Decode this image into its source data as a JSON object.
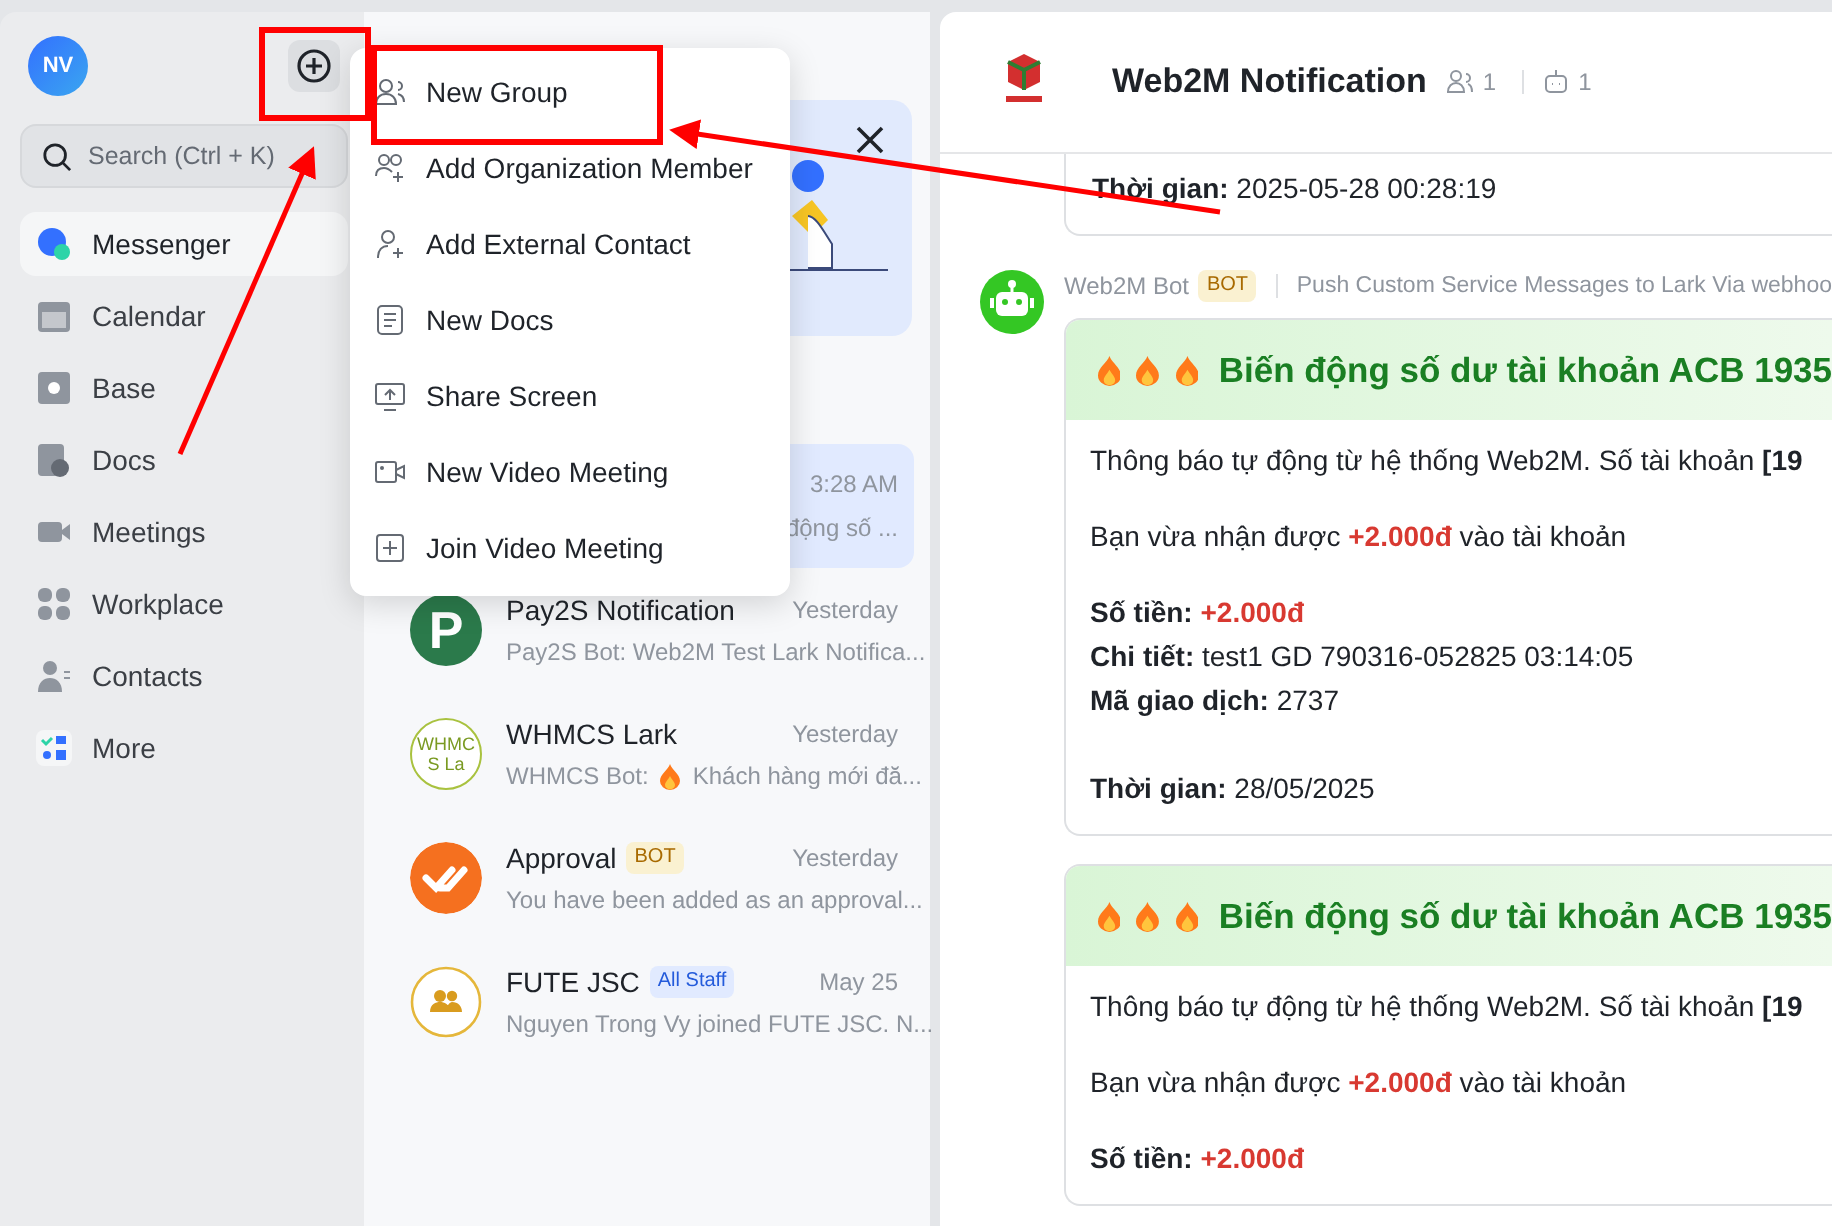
{
  "sidebar": {
    "avatar": "NV",
    "search": {
      "placeholder": "Search (Ctrl + K)"
    },
    "items": [
      {
        "label": "Messenger",
        "selected": true
      },
      {
        "label": "Calendar",
        "selected": false
      },
      {
        "label": "Base",
        "selected": false
      },
      {
        "label": "Docs",
        "selected": false
      },
      {
        "label": "Meetings",
        "selected": false
      },
      {
        "label": "Workplace",
        "selected": false
      },
      {
        "label": "Contacts",
        "selected": false
      },
      {
        "label": "More",
        "selected": false
      }
    ]
  },
  "create_menu": {
    "items": [
      {
        "label": "New Group"
      },
      {
        "label": "Add Organization Member"
      },
      {
        "label": "Add External Contact"
      },
      {
        "label": "New Docs"
      },
      {
        "label": "Share Screen"
      },
      {
        "label": "New Video Meeting"
      },
      {
        "label": "Join Video Meeting"
      }
    ]
  },
  "chat_list": {
    "partial_item": {
      "time": "3:28 AM",
      "preview": "động số ...",
      "selected": true
    },
    "items": [
      {
        "name": "Pay2S Notification",
        "kind": "letter",
        "avatar_text": "P",
        "time": "Yesterday",
        "preview": "Pay2S Bot: Web2M Test Lark Notifica...",
        "selected": false
      },
      {
        "name": "WHMCS Lark",
        "kind": "text",
        "avatar_text": "WHMC S La",
        "time": "Yesterday",
        "preview": "WHMCS Bot:",
        "preview_tail": "Khách hàng mới đă...",
        "selected": false
      },
      {
        "name": "Approval",
        "kind": "approval",
        "tag": {
          "kind": "bot",
          "label": "BOT"
        },
        "time": "Yesterday",
        "preview": "You have been added as an approval...",
        "selected": false
      },
      {
        "name": "FUTE JSC",
        "kind": "group",
        "tag": {
          "kind": "staff",
          "label": "All Staff"
        },
        "time": "May 25",
        "preview": "Nguyen Trong Vy joined FUTE JSC. N...",
        "selected": false
      }
    ]
  },
  "chat": {
    "title": "Web2M Notification",
    "members": "1",
    "bots": "1",
    "prev_time": {
      "label": "Thời gian:",
      "value": "2025-05-28 00:28:19"
    },
    "sender": {
      "name": "Web2M Bot",
      "badge": "BOT",
      "description": "Push Custom Service Messages to Lark Via webhoo"
    },
    "cards": [
      {
        "title": "Biến động số dư tài khoản ACB 1935",
        "intro": "Thông báo tự động từ hệ thống Web2M. Số tài khoản **[19**",
        "received": "Bạn vừa nhận được **+2.000đ** vào tài khoản",
        "fields": [
          {
            "label": "Số tiền:",
            "value": "+2.000đ",
            "highlight": true
          },
          {
            "label": "Chi tiết:",
            "value": "test1 GD 790316-052825 03:14:05",
            "highlight": false
          },
          {
            "label": "Mã giao dịch:",
            "value": "2737",
            "highlight": false
          }
        ],
        "time": {
          "label": "Thời gian:",
          "value": "28/05/2025"
        }
      },
      {
        "title": "Biến động số dư tài khoản ACB 1935",
        "intro": "Thông báo tự động từ hệ thống Web2M. Số tài khoản **[19**",
        "received": "Bạn vừa nhận được **+2.000đ** vào tài khoản",
        "fields": [
          {
            "label": "Số tiền:",
            "value": "+2.000đ",
            "highlight": true
          }
        ]
      }
    ]
  }
}
